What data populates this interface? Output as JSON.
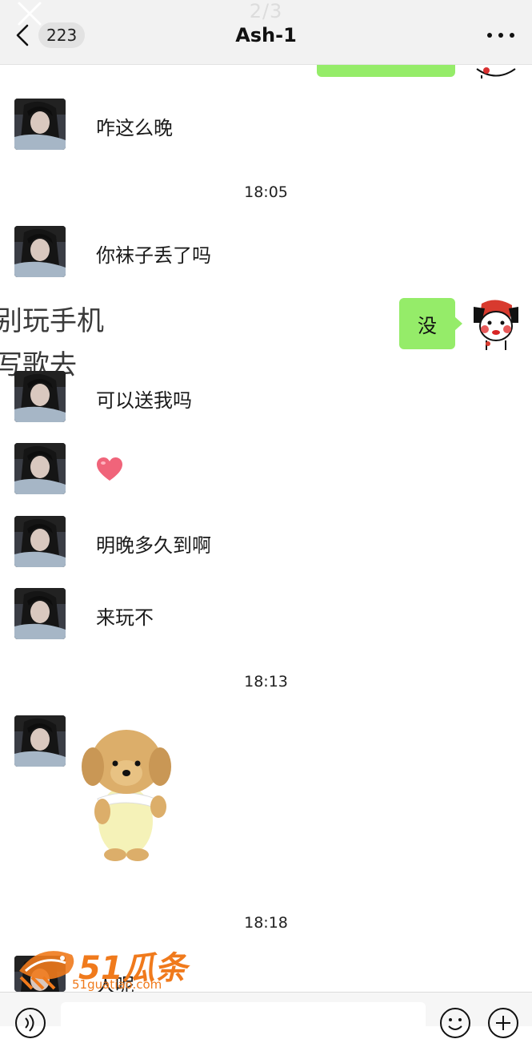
{
  "viewer": {
    "page_indicator": "2/3"
  },
  "header": {
    "unread_count": "223",
    "title": "Ash-1"
  },
  "messages": {
    "m1": "咋这么晚",
    "t1": "18:05",
    "m2": "你袜子丢了吗",
    "self_reply": "没",
    "overlay_line1": "别玩手机",
    "overlay_line2": "写歌去",
    "m3": "可以送我吗",
    "m5": "明晚多久到啊",
    "m6": "来玩不",
    "t2": "18:13",
    "t3": "18:18",
    "m8": "人呢"
  },
  "watermark": {
    "brand": "51瓜条",
    "domain": "51guatiao.com"
  },
  "colors": {
    "bubble": "#95ec69",
    "header_bg": "#f2f2f2",
    "heart": "#f0647a",
    "watermark": "#f07a1c"
  },
  "icons": [
    "close-icon",
    "back-chevron-icon",
    "more-icon",
    "heart-icon",
    "voice-icon",
    "emoji-icon",
    "plus-icon"
  ]
}
